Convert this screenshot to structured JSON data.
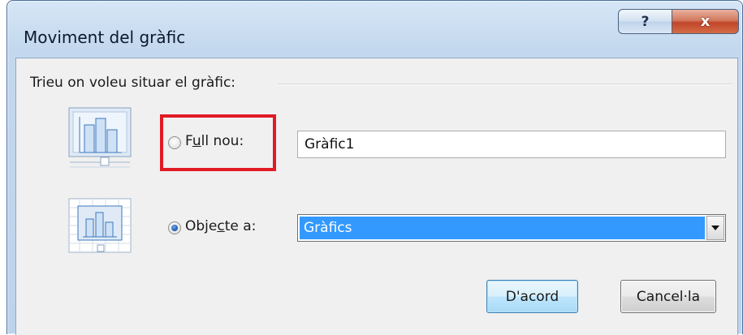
{
  "window": {
    "title": "Moviment del gràfic",
    "help_glyph": "?",
    "close_glyph": "x"
  },
  "group": {
    "label": "Trieu on voleu situar el gràfic:"
  },
  "option_new_sheet": {
    "label_prefix": "F",
    "label_mnemonic": "u",
    "label_suffix": "ll nou:",
    "selected": false,
    "input_value": "Gràfic1",
    "icon": "chart-new-sheet-icon"
  },
  "option_object": {
    "label_prefix": "Obje",
    "label_mnemonic": "c",
    "label_suffix": "te a:",
    "selected": true,
    "combo_value": "Gràfics",
    "icon": "chart-in-sheet-icon"
  },
  "buttons": {
    "ok": "D'acord",
    "cancel": "Cancel·la"
  },
  "colors": {
    "highlight": "#e11a24",
    "selection": "#3399ff",
    "close_button": "#c1462a"
  }
}
